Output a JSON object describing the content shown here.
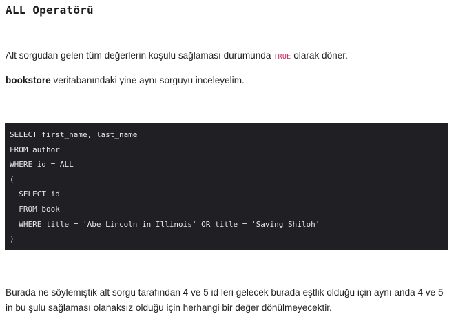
{
  "heading": "ALL Operatörü",
  "paragraph1": {
    "before": "Alt sorgudan gelen tüm değerlerin koşulu sağlaması durumunda ",
    "code": "TRUE",
    "after": " olarak döner."
  },
  "paragraph2": {
    "bold": "bookstore",
    "rest": " veritabanındaki yine aynı sorguyu inceleyelim."
  },
  "code_block": {
    "lines": [
      "SELECT first_name, last_name",
      "FROM author",
      "WHERE id = ALL",
      "(",
      "  SELECT id",
      "  FROM book",
      "  WHERE title = 'Abe Lincoln in Illinois' OR title = 'Saving Shiloh'",
      ")"
    ]
  },
  "paragraph3": "Burada ne söylemiştik alt sorgu tarafından 4 ve 5 id leri gelecek burada eştlik olduğu için aynı anda 4 ve 5 in bu şulu sağlaması olanaksız olduğu için herhangi bir değer dönülmeyecektir.",
  "colors": {
    "code_background": "#1f1f24",
    "code_text": "#e6e6e6",
    "inline_code": "#c2255c"
  }
}
